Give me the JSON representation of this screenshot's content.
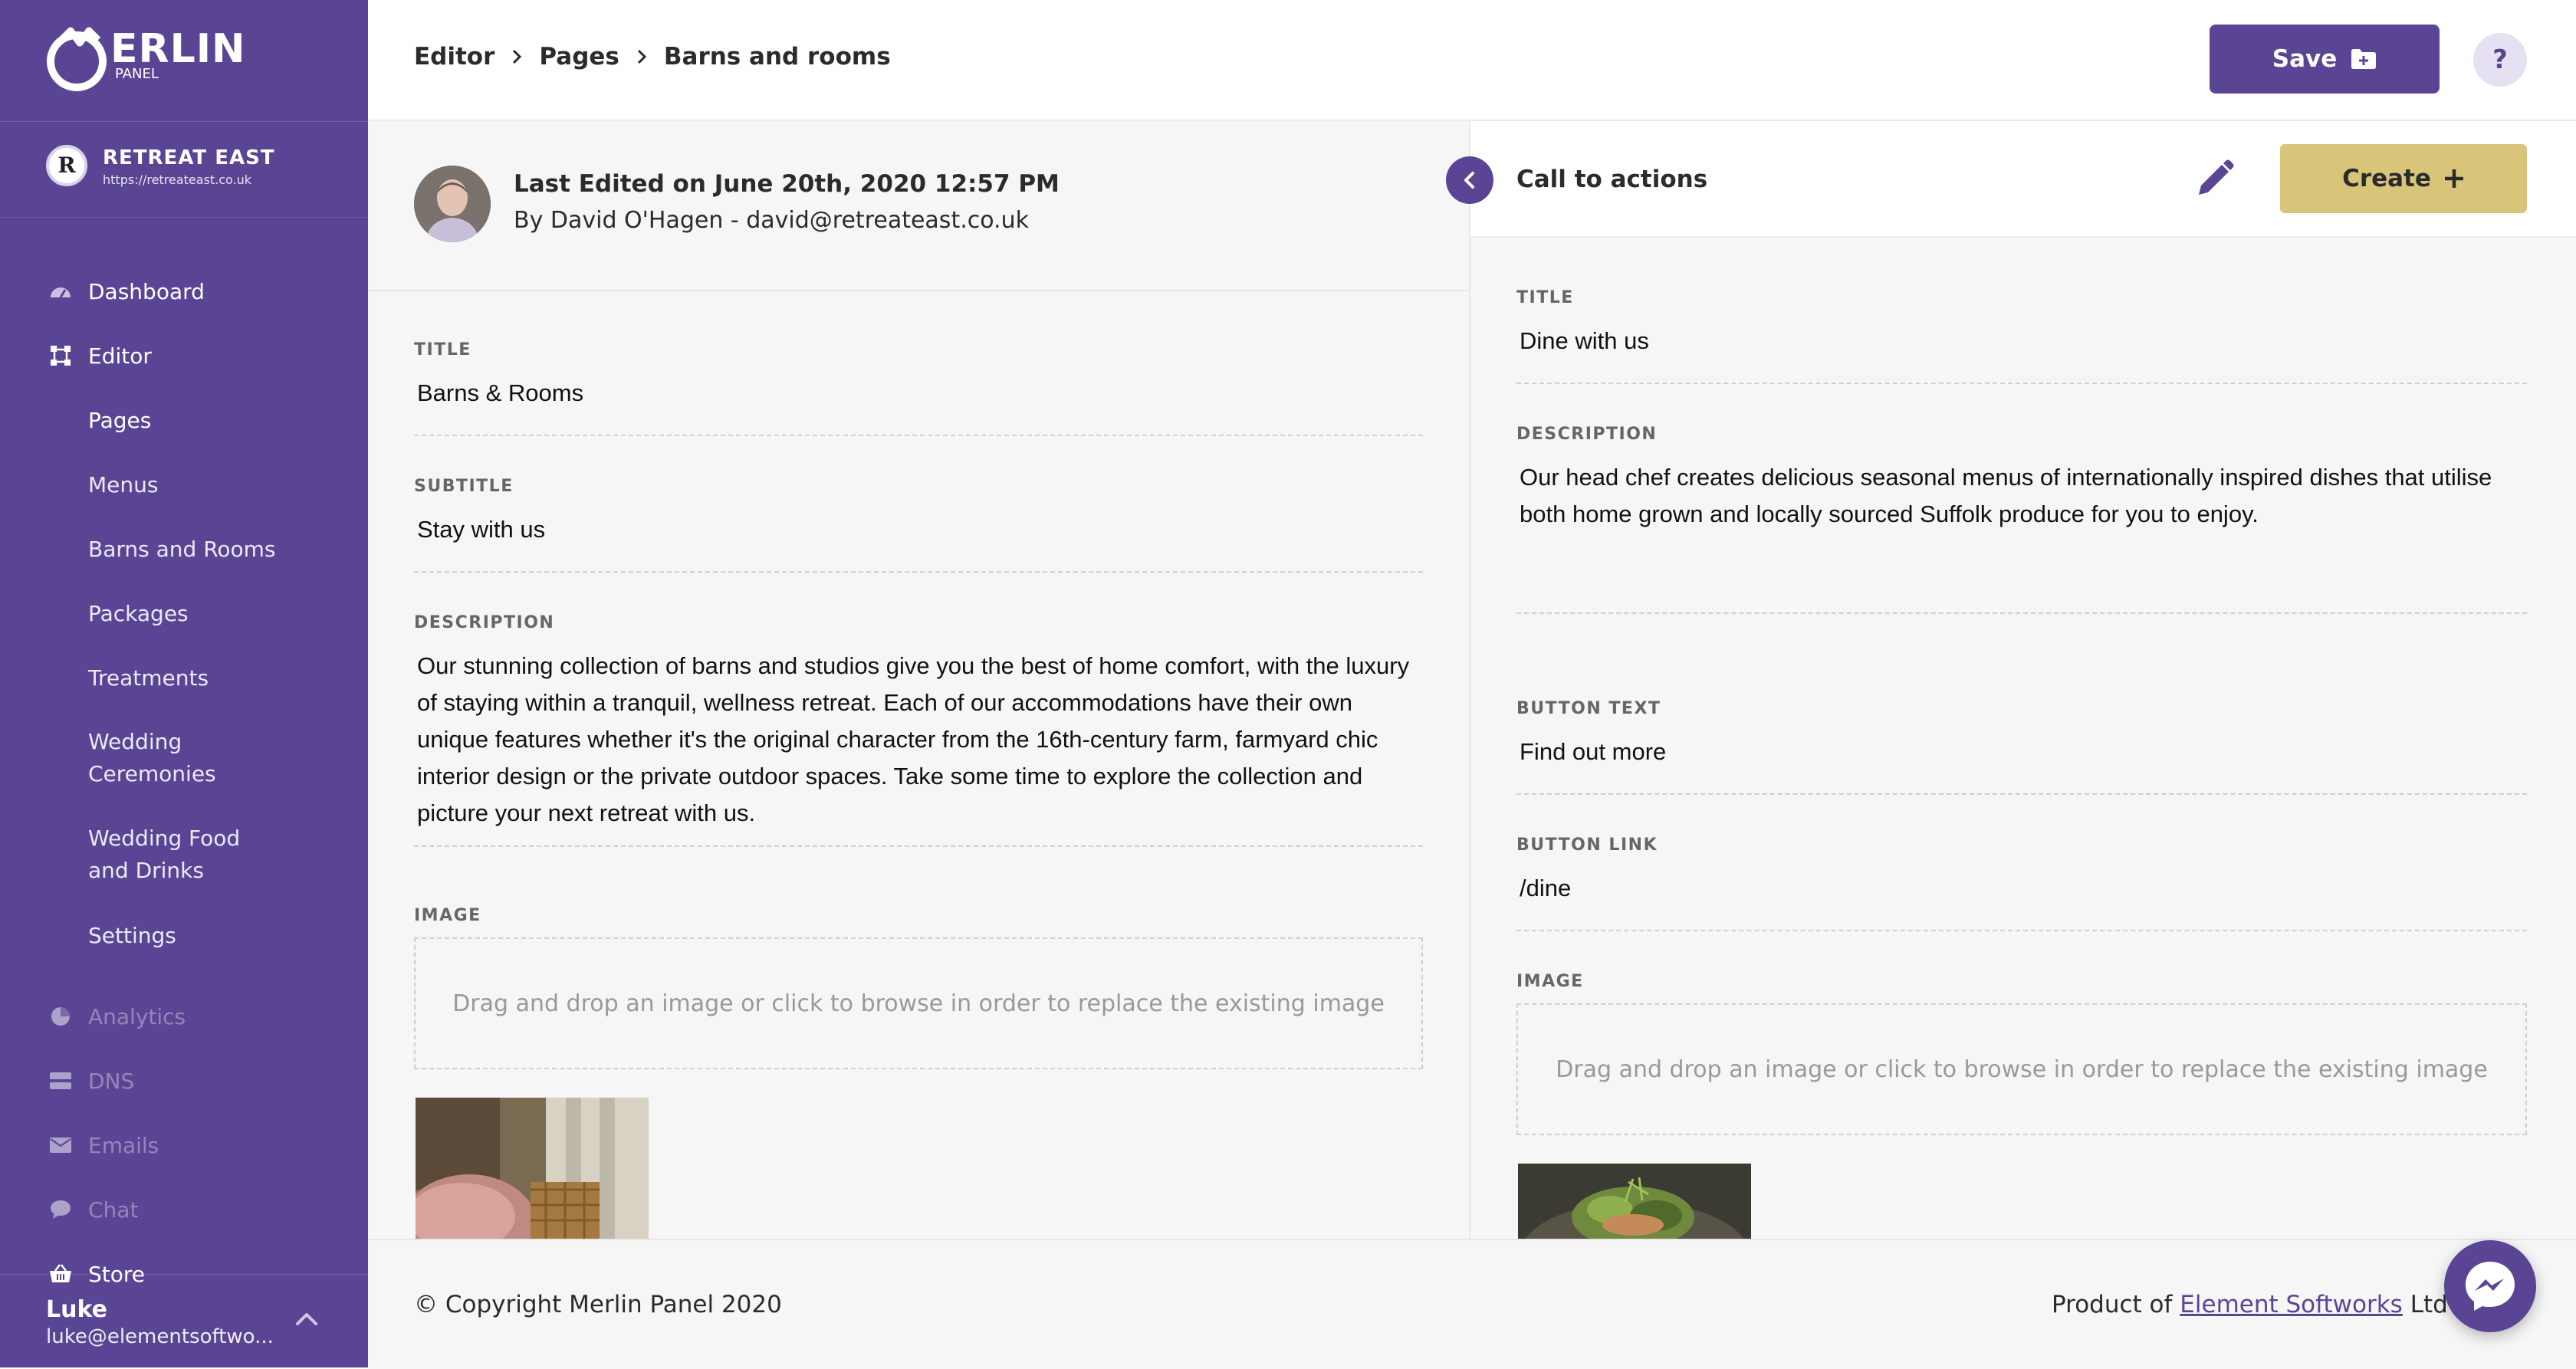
{
  "brand": {
    "name": "ERLIN",
    "sub": "PANEL"
  },
  "site": {
    "badge": "R",
    "name": "RETREAT EAST",
    "url": "https://retreateast.co.uk"
  },
  "nav": {
    "dashboard": "Dashboard",
    "editor": "Editor",
    "pages": "Pages",
    "menus": "Menus",
    "barns": "Barns and Rooms",
    "packages": "Packages",
    "treatments": "Treatments",
    "wedding_ceremonies_1": "Wedding",
    "wedding_ceremonies_2": "Ceremonies",
    "wedding_food_1": "Wedding Food",
    "wedding_food_2": "and Drinks",
    "settings": "Settings",
    "analytics": "Analytics",
    "dns": "DNS",
    "emails": "Emails",
    "chat": "Chat",
    "store": "Store"
  },
  "user": {
    "name": "Luke",
    "email": "luke@elementsoftwo..."
  },
  "breadcrumb": {
    "root": "Editor",
    "section": "Pages",
    "current": "Barns and rooms"
  },
  "toolbar": {
    "save_label": "Save",
    "help_label": "?"
  },
  "edited": {
    "title": "Last Edited on June 20th, 2020 12:57 PM",
    "by": "By David O'Hagen - david@retreateast.co.uk"
  },
  "page_form": {
    "title_label": "TITLE",
    "title_value": "Barns & Rooms",
    "subtitle_label": "SUBTITLE",
    "subtitle_value": "Stay with us",
    "description_label": "DESCRIPTION",
    "description_value": "Our stunning collection of barns and studios give you the best of home comfort, with the luxury of staying within a tranquil, wellness retreat. Each of our accommodations have their own unique features whether it's the original character from the 16th-century farm, farmyard chic interior design or the private outdoor spaces. Take some time to explore the collection and picture your next retreat with us.",
    "image_label": "IMAGE",
    "dropzone_text": "Drag and drop an image or click to browse in order to replace the existing image"
  },
  "cta": {
    "header": "Call to actions",
    "create_label": "Create",
    "title_label": "TITLE",
    "title_value": "Dine with us",
    "description_label": "DESCRIPTION",
    "description_value": "Our head chef creates delicious seasonal menus of internationally inspired dishes that utilise both home grown and locally sourced Suffolk produce for you to enjoy.",
    "button_text_label": "BUTTON TEXT",
    "button_text_value": "Find out more",
    "button_link_label": "BUTTON LINK",
    "button_link_value": "/dine",
    "image_label": "IMAGE",
    "dropzone_text": "Drag and drop an image or click to browse in order to replace the existing image"
  },
  "footer": {
    "copyright": "© Copyright Merlin Panel 2020",
    "product_prefix": "Product of ",
    "product_link": "Element Softworks",
    "product_suffix": " Ltd"
  },
  "colors": {
    "primary": "#5a4594",
    "accent": "#d9c57a",
    "panel_bg": "#f6f6f7"
  }
}
